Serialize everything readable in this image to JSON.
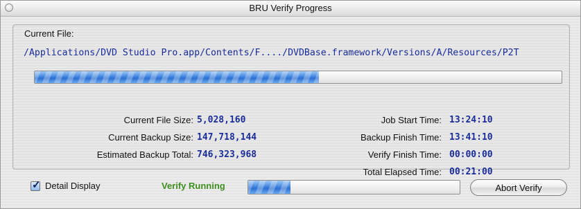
{
  "window": {
    "title": "BRU Verify Progress"
  },
  "current_file": {
    "label": "Current File:",
    "path": "/Applications/DVD Studio Pro.app/Contents/F..../DVDBase.framework/Versions/A/Resources/P2T",
    "progress_fraction": 0.54
  },
  "stats_left": [
    {
      "label": "Current File Size:",
      "value": "5,028,160"
    },
    {
      "label": "Current Backup Size:",
      "value": "147,718,144"
    },
    {
      "label": "Estimated Backup Total:",
      "value": "746,323,968"
    }
  ],
  "stats_right": [
    {
      "label": "Job Start Time:",
      "value": "13:24:10"
    },
    {
      "label": "Backup Finish Time:",
      "value": "13:41:10"
    },
    {
      "label": "Verify Finish Time:",
      "value": "00:00:00"
    },
    {
      "label": "Total Elapsed Time:",
      "value": "00:21:00"
    }
  ],
  "footer": {
    "detail_display_label": "Detail Display",
    "detail_display_checked": true,
    "status_text": "Verify Running",
    "verify_progress_fraction": 0.2,
    "abort_button_label": "Abort Verify"
  },
  "colors": {
    "value_text": "#1a2c9a",
    "status_text": "#3d8f1f",
    "progress_fill": "#4d8ee4"
  }
}
